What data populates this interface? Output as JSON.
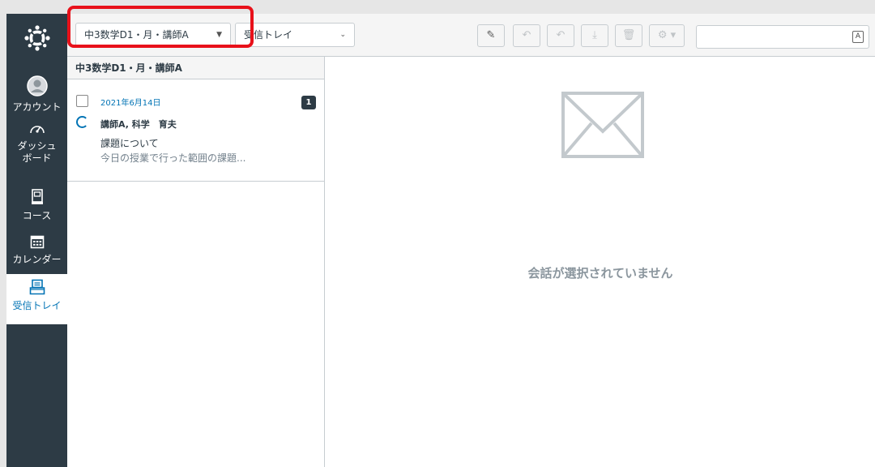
{
  "sidebar": {
    "items": [
      {
        "label": "アカウント",
        "icon": "account-icon"
      },
      {
        "label": "ダッシュ\nボード",
        "label_line1": "ダッシュ",
        "label_line2": "ボード",
        "icon": "dashboard-icon"
      },
      {
        "label": "コース",
        "icon": "courses-icon"
      },
      {
        "label": "カレンダー",
        "icon": "calendar-icon"
      },
      {
        "label": "受信トレイ",
        "icon": "inbox-icon",
        "active": true
      }
    ]
  },
  "toolbar": {
    "course_select": "中3数学D1・月・講師A",
    "mailbox_select": "受信トレイ",
    "compose_icon": "compose-icon",
    "reply_icon": "reply-icon",
    "reply_all_icon": "reply-all-icon",
    "archive_icon": "archive-icon",
    "delete_icon": "trash-icon",
    "settings_icon": "gear-icon",
    "search_value": ""
  },
  "list": {
    "header": "中3数学D1・月・講師A",
    "conversations": [
      {
        "date": "2021年6月14日",
        "count": "1",
        "sender": "講師A, 科学　育夫",
        "subject": "課題について",
        "preview": "今日の授業で行った範囲の課題..."
      }
    ]
  },
  "detail": {
    "empty_message": "会話が選択されていません"
  },
  "colors": {
    "sidebar_bg": "#2d3b45",
    "accent": "#0374b5",
    "highlight": "#e8111a"
  }
}
